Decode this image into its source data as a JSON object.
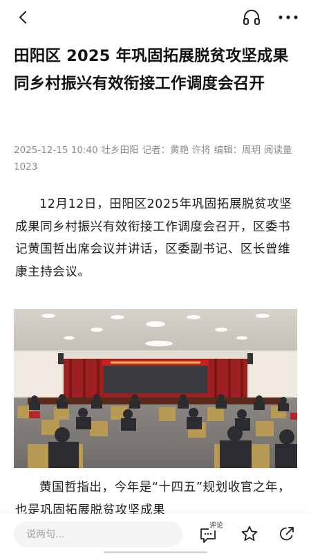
{
  "header": {
    "back_icon": "chevron-left-icon",
    "audio_icon": "headphones-icon",
    "more_icon": "ellipsis-icon"
  },
  "article": {
    "title": "田阳区 2025 年巩固拓展脱贫攻坚成果同乡村振兴有效衔接工作调度会召开",
    "datetime": "2025-12-15 10:40",
    "source": "壮乡田阳",
    "reporter": "记者：黄艳 许将",
    "editor": "编辑：周玥",
    "reads": "阅读量1023",
    "paragraph1": "12月12日，田阳区2025年巩固拓展脱贫攻坚成果同乡村振兴有效衔接工作调度会召开，区委书记黄国哲出席会议并讲话，区委副书记、区长曾维康主持会议。",
    "paragraph2": "黄国哲指出，今年是“十四五”规划收官之年，也是巩固拓展脱贫攻坚成果"
  },
  "bottom_bar": {
    "comment_placeholder": "说两句...",
    "comment_label": "评论",
    "comment_icon": "comment-icon",
    "favorite_icon": "star-icon",
    "share_icon": "share-icon"
  }
}
